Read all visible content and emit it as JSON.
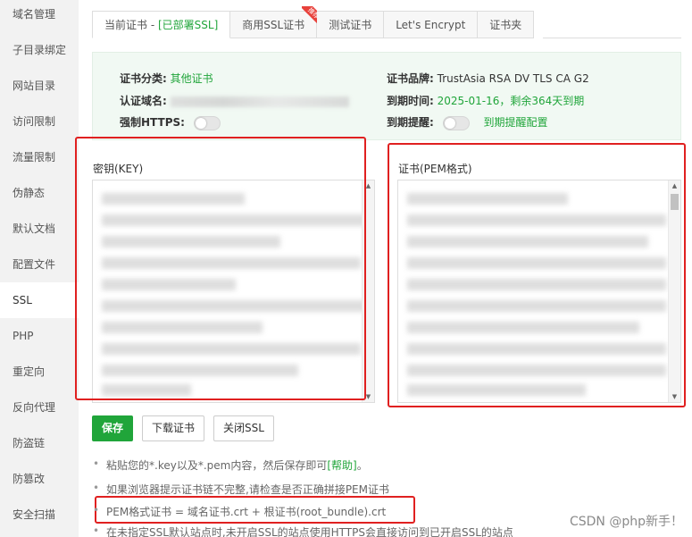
{
  "sidebar": {
    "items": [
      {
        "label": "域名管理"
      },
      {
        "label": "子目录绑定"
      },
      {
        "label": "网站目录"
      },
      {
        "label": "访问限制"
      },
      {
        "label": "流量限制"
      },
      {
        "label": "伪静态"
      },
      {
        "label": "默认文档"
      },
      {
        "label": "配置文件"
      },
      {
        "label": "SSL"
      },
      {
        "label": "PHP"
      },
      {
        "label": "重定向"
      },
      {
        "label": "反向代理"
      },
      {
        "label": "防盗链"
      },
      {
        "label": "防篡改"
      },
      {
        "label": "安全扫描"
      }
    ],
    "active": "SSL"
  },
  "tabs": {
    "current": "当前证书 - ",
    "current_status": "[已部署SSL]",
    "commercial": "商用SSL证书",
    "commercial_badge": "推荐",
    "test": "测试证书",
    "letsencrypt": "Let's Encrypt",
    "folder": "证书夹"
  },
  "cert_info": {
    "category_label": "证书分类:",
    "category_value": "其他证书",
    "domain_label": "认证域名:",
    "force_https_label": "强制HTTPS:",
    "brand_label": "证书品牌:",
    "brand_value": "TrustAsia RSA DV TLS CA G2",
    "expiry_label": "到期时间:",
    "expiry_value": "2025-01-16，剩余364天到期",
    "reminder_label": "到期提醒:",
    "reminder_link": "到期提醒配置"
  },
  "key_field": {
    "label": "密钥(KEY)"
  },
  "pem_field": {
    "label": "证书(PEM格式)"
  },
  "buttons": {
    "save": "保存",
    "download": "下载证书",
    "close_ssl": "关闭SSL"
  },
  "tips": {
    "tip1_text": "粘贴您的*.key以及*.pem内容，然后保存即可",
    "tip1_link": "[帮助]",
    "tip1_end": "。",
    "tip2": "如果浏览器提示证书链不完整,请检查是否正确拼接PEM证书",
    "tip3": "PEM格式证书 = 域名证书.crt + 根证书(root_bundle).crt",
    "tip4": "在未指定SSL默认站点时,未开启SSL的站点使用HTTPS会直接访问到已开启SSL的站点"
  },
  "watermark": "CSDN @php新手！",
  "colors": {
    "accent": "#20a53a",
    "highlight_box": "#e02020",
    "info_bg": "#f1f9f3"
  }
}
